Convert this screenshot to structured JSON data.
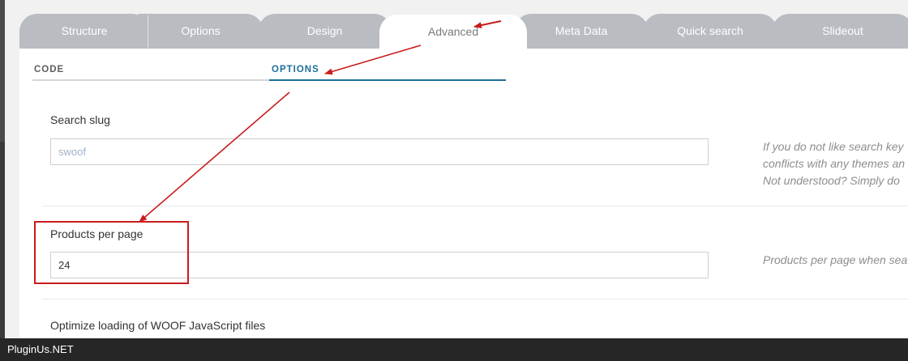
{
  "tabs": [
    {
      "label": "Structure"
    },
    {
      "label": "Options"
    },
    {
      "label": "Design"
    },
    {
      "label": "Advanced",
      "active": true
    },
    {
      "label": "Meta Data"
    },
    {
      "label": "Quick search"
    },
    {
      "label": "Slideout"
    }
  ],
  "subtabs": [
    {
      "label": "CODE",
      "active": false
    },
    {
      "label": "OPTIONS",
      "active": true
    }
  ],
  "fields": {
    "search_slug": {
      "label": "Search slug",
      "value": "",
      "placeholder": "swoof",
      "hint": [
        "If you do not like search key",
        "conflicts with any themes an",
        "Not understood? Simply do"
      ]
    },
    "products_per_page": {
      "label": "Products per page",
      "value": "24",
      "hint": [
        "Products per page when sea"
      ]
    },
    "optimize_js": {
      "label": "Optimize loading of WOOF JavaScript files"
    }
  },
  "footer": {
    "text": "PluginUs.NET"
  },
  "colors": {
    "tab_inactive": "#b9bcc1",
    "subtab_active": "#1e6e9a",
    "subtab_inactive": "#d6d6d6",
    "annotation": "#c91c1c"
  }
}
